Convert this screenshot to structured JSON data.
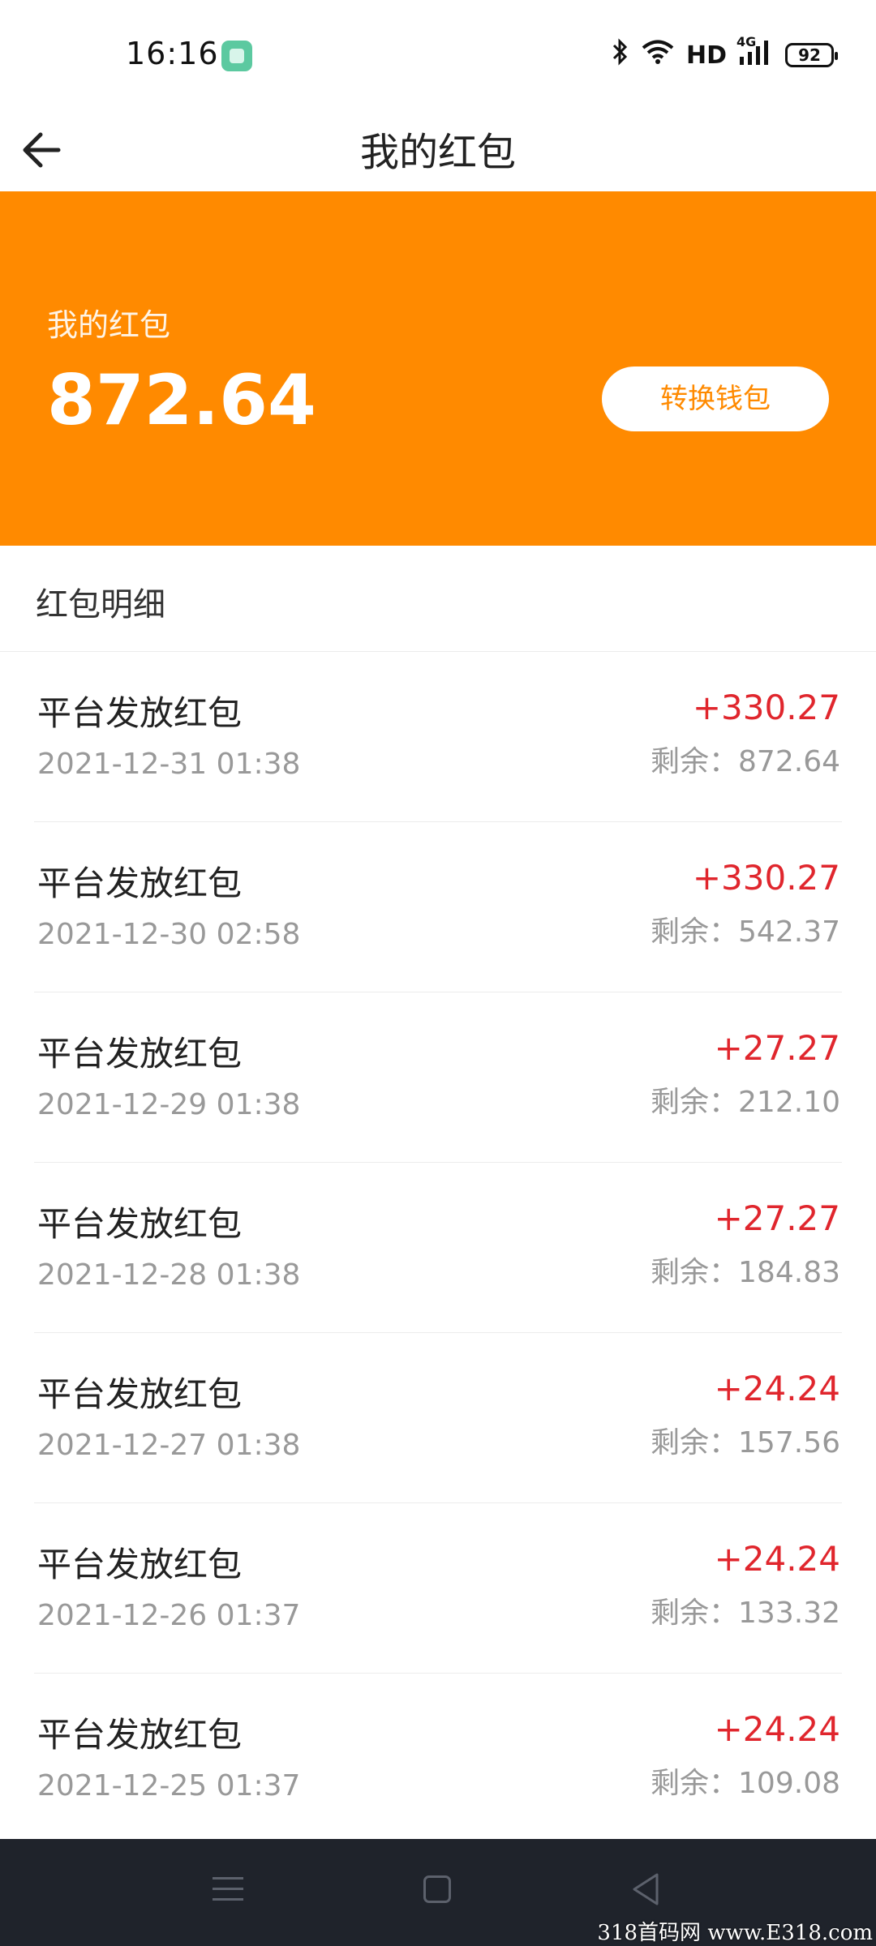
{
  "status_bar": {
    "time": "16:16",
    "network": "HD",
    "signal_label": "4G",
    "battery": "92",
    "icons": [
      "app-icon",
      "bluetooth-icon",
      "wifi-icon",
      "signal-icon",
      "battery-icon"
    ]
  },
  "header": {
    "title": "我的红包",
    "back_icon": "back-arrow-icon"
  },
  "banner": {
    "label": "我的红包",
    "amount": "872.64",
    "convert_button": "转换钱包",
    "color": "#ff8a00"
  },
  "section": {
    "title": "红包明细"
  },
  "records": [
    {
      "title": "平台发放红包",
      "date": "2021-12-31 01:38",
      "amount": "+330.27",
      "balance": "剩余：872.64"
    },
    {
      "title": "平台发放红包",
      "date": "2021-12-30 02:58",
      "amount": "+330.27",
      "balance": "剩余：542.37"
    },
    {
      "title": "平台发放红包",
      "date": "2021-12-29 01:38",
      "amount": "+27.27",
      "balance": "剩余：212.10"
    },
    {
      "title": "平台发放红包",
      "date": "2021-12-28 01:38",
      "amount": "+27.27",
      "balance": "剩余：184.83"
    },
    {
      "title": "平台发放红包",
      "date": "2021-12-27 01:38",
      "amount": "+24.24",
      "balance": "剩余：157.56"
    },
    {
      "title": "平台发放红包",
      "date": "2021-12-26 01:37",
      "amount": "+24.24",
      "balance": "剩余：133.32"
    },
    {
      "title": "平台发放红包",
      "date": "2021-12-25 01:37",
      "amount": "+24.24",
      "balance": "剩余：109.08"
    }
  ],
  "nav_bar": {
    "icons": [
      "menu-icon",
      "home-icon",
      "back-icon"
    ]
  },
  "watermark": "318首码网 www.E318.com",
  "colors": {
    "accent": "#ff8a00",
    "amount_red": "#e0262d",
    "nav_bg": "#1f232b"
  }
}
